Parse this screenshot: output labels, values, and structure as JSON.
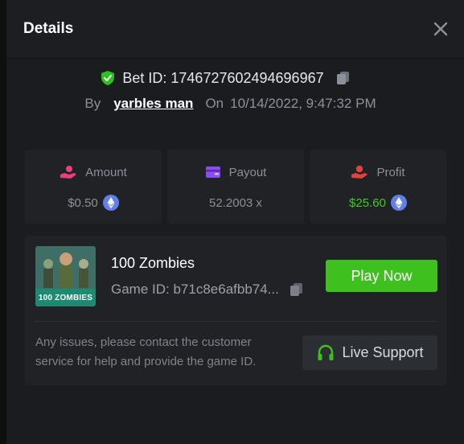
{
  "header": {
    "title": "Details"
  },
  "bet": {
    "id_text": "Bet ID: 1746727602494696967",
    "by_label": "By",
    "username": "yarbles man",
    "on_label": "On",
    "datetime": "10/14/2022, 9:47:32 PM"
  },
  "stats": [
    {
      "label": "Amount",
      "value": "$0.50",
      "icon": "hand-coins-icon",
      "currency_icon": "ethereum-icon"
    },
    {
      "label": "Payout",
      "value": "52.2003 x",
      "icon": "wallet-icon"
    },
    {
      "label": "Profit",
      "value": "$25.60",
      "icon": "hand-profit-icon",
      "currency_icon": "ethereum-icon"
    }
  ],
  "game": {
    "name": "100 Zombies",
    "game_id_text": "Game ID: b71c8e6afbb74...",
    "thumbnail_label": "100 ZOMBIES",
    "play_label": "Play Now"
  },
  "support": {
    "help_text": "Any issues, please contact the customer service for help and provide the game ID.",
    "button_label": "Live Support"
  },
  "colors": {
    "background": "#1a1c20",
    "card": "#202226",
    "accent_green": "#3ec11f",
    "profit_green": "#3ecb23",
    "amount_icon_pink": "#e8407a",
    "payout_icon_purple": "#8c4bf5",
    "profit_icon_red": "#e0433a"
  }
}
